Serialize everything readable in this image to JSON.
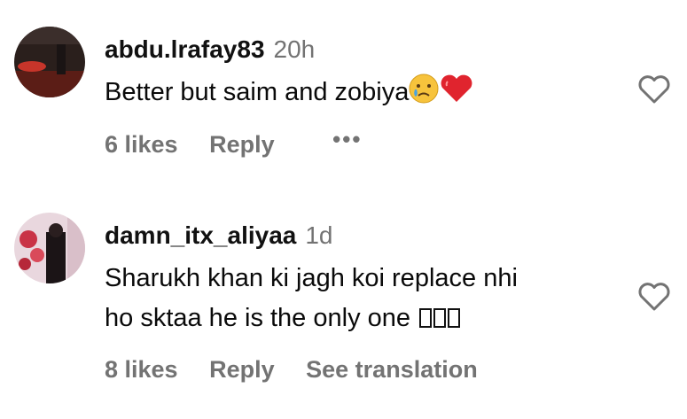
{
  "comments": [
    {
      "username": "abdu.lrafay83",
      "time": "20h",
      "text_line1": "Better but saim and zobiya",
      "likes": "6 likes",
      "reply": "Reply",
      "more": "•••",
      "emojis": [
        "crying-face-icon",
        "heart-icon"
      ]
    },
    {
      "username": "damn_itx_aliyaa",
      "time": "1d",
      "text_line1": "Sharukh khan ki jagh koi replace nhi",
      "text_line2": "ho sktaa he is the only one",
      "likes": "8 likes",
      "reply": "Reply",
      "see_translation": "See translation"
    }
  ],
  "colors": {
    "muted": "#737373",
    "heart_red": "#e0245e",
    "text": "#0a0a0a"
  }
}
